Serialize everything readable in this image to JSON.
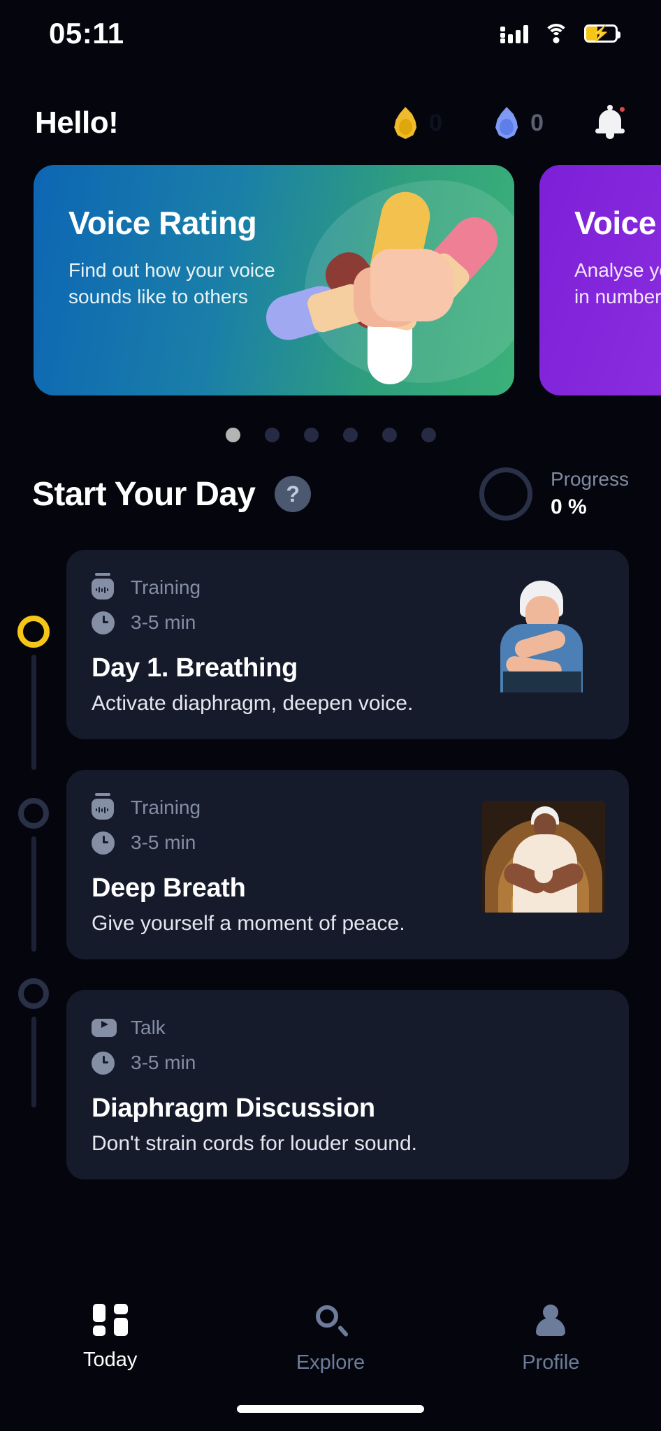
{
  "status_bar": {
    "time": "05:11",
    "icons": [
      "signal-icon",
      "wifi-icon",
      "battery-charging-icon"
    ]
  },
  "header": {
    "greeting": "Hello!",
    "streak_flame_value": "0",
    "streak_blue_value": "0",
    "notification_icon": "bell-icon",
    "has_notification_dot": true
  },
  "carousel": {
    "cards": [
      {
        "title": "Voice Rating",
        "subtitle": "Find out how your voice sounds like to others",
        "accent": "#2f9f7d"
      },
      {
        "title": "Voice",
        "subtitle": "Analyse your pitch & voice in numbers",
        "accent": "#8d2fe0"
      }
    ],
    "dots_total": 6,
    "dots_active_index": 0
  },
  "section": {
    "title": "Start Your Day",
    "help_label": "?",
    "progress_label": "Progress",
    "progress_value": "0 %",
    "progress_percent": 0
  },
  "tasks": [
    {
      "type_label": "Training",
      "type_icon": "microphone-icon",
      "duration_label": "3-5 min",
      "duration_icon": "clock-icon",
      "title": "Day 1. Breathing",
      "description": "Activate diaphragm, deepen voice.",
      "thumbnail": "breathing-illustration",
      "state": "active"
    },
    {
      "type_label": "Training",
      "type_icon": "microphone-icon",
      "duration_label": "3-5 min",
      "duration_icon": "clock-icon",
      "title": "Deep Breath",
      "description": "Give yourself a moment of peace.",
      "thumbnail": "meditation-illustration",
      "state": "upcoming"
    },
    {
      "type_label": "Talk",
      "type_icon": "play-video-icon",
      "duration_label": "3-5 min",
      "duration_icon": "clock-icon",
      "title": "Diaphragm Discussion",
      "description": "Don't strain cords for louder sound.",
      "thumbnail": "",
      "state": "upcoming"
    }
  ],
  "bottom_nav": {
    "items": [
      {
        "label": "Today",
        "icon": "grid-icon",
        "active": true
      },
      {
        "label": "Explore",
        "icon": "search-icon",
        "active": false
      },
      {
        "label": "Profile",
        "icon": "person-icon",
        "active": false
      }
    ]
  },
  "colors": {
    "background": "#05060d",
    "card": "#161b2c",
    "accent_gold": "#f5c518",
    "muted_text": "#848ea4"
  }
}
